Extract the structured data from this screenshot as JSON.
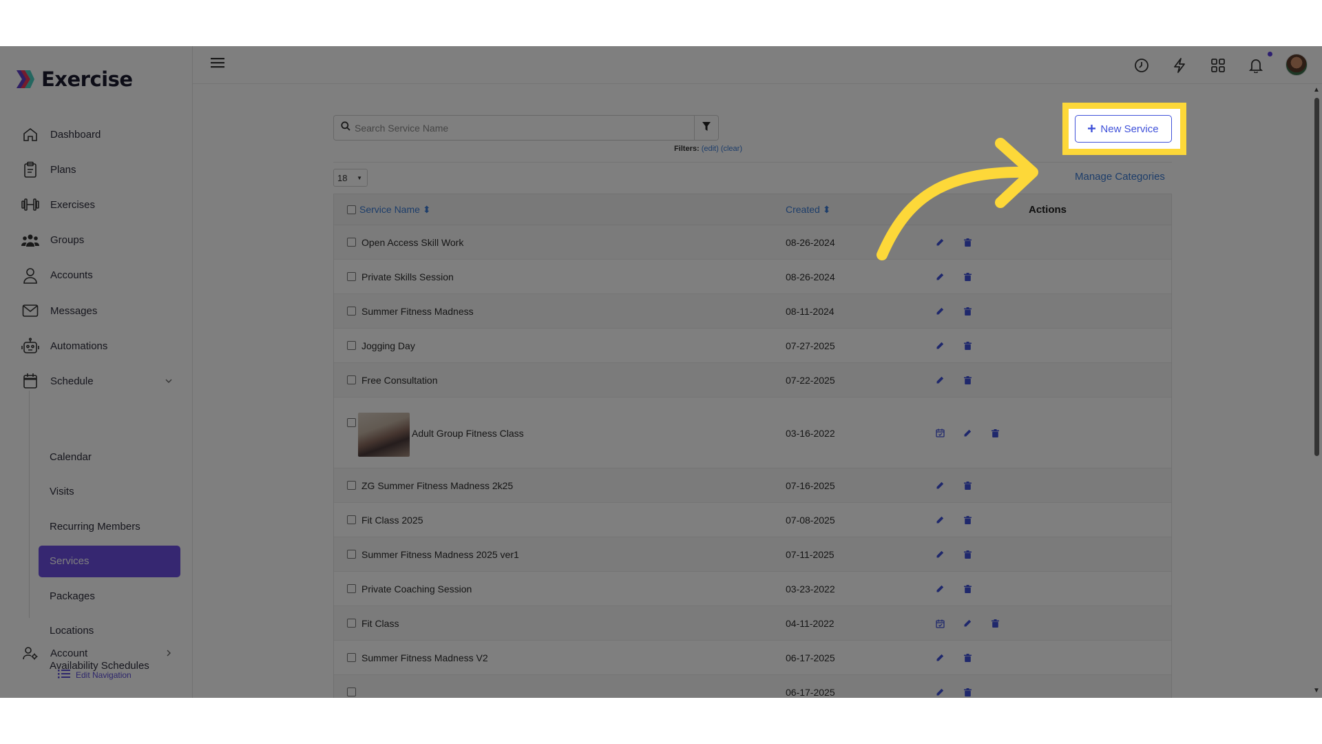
{
  "app": {
    "name": "Exercise"
  },
  "sidebar": {
    "items": [
      {
        "label": "Dashboard",
        "icon": "home-icon"
      },
      {
        "label": "Plans",
        "icon": "clipboard-icon"
      },
      {
        "label": "Exercises",
        "icon": "dumbbell-icon"
      },
      {
        "label": "Groups",
        "icon": "users-icon"
      },
      {
        "label": "Accounts",
        "icon": "user-icon"
      },
      {
        "label": "Messages",
        "icon": "envelope-icon"
      },
      {
        "label": "Automations",
        "icon": "robot-icon"
      },
      {
        "label": "Schedule",
        "icon": "calendar-icon"
      }
    ],
    "schedule_children": [
      {
        "label": "Calendar"
      },
      {
        "label": "Visits"
      },
      {
        "label": "Recurring Members"
      },
      {
        "label": "Services",
        "active": true
      },
      {
        "label": "Packages"
      },
      {
        "label": "Locations"
      },
      {
        "label": "Availability Schedules"
      }
    ],
    "account": {
      "label": "Account",
      "icon": "user-gear-icon"
    },
    "edit_navigation": "Edit Navigation"
  },
  "topbar": {
    "icons": [
      "clock-icon",
      "bolt-icon",
      "grid-icon",
      "bell-icon"
    ]
  },
  "search": {
    "placeholder": "Search Service Name"
  },
  "filters": {
    "label": "Filters:",
    "edit": "(edit)",
    "clear": "(clear)"
  },
  "per_page": "18",
  "manage_categories": "Manage Categories",
  "new_service": "New Service",
  "table": {
    "headers": {
      "name": "Service Name",
      "created": "Created",
      "actions": "Actions"
    },
    "rows": [
      {
        "name": "Open Access Skill Work",
        "created": "08-26-2024",
        "calendar": false
      },
      {
        "name": "Private Skills Session",
        "created": "08-26-2024",
        "calendar": false
      },
      {
        "name": "Summer Fitness Madness",
        "created": "08-11-2024",
        "calendar": false
      },
      {
        "name": "Jogging Day",
        "created": "07-27-2025",
        "calendar": false
      },
      {
        "name": "Free Consultation",
        "created": "07-22-2025",
        "calendar": false
      },
      {
        "name": "Adult Group Fitness Class",
        "created": "03-16-2022",
        "calendar": true,
        "thumbnail": true
      },
      {
        "name": "ZG Summer Fitness Madness 2k25",
        "created": "07-16-2025",
        "calendar": false
      },
      {
        "name": "Fit Class 2025",
        "created": "07-08-2025",
        "calendar": false
      },
      {
        "name": "Summer Fitness Madness 2025 ver1",
        "created": "07-11-2025",
        "calendar": false
      },
      {
        "name": "Private Coaching Session",
        "created": "03-23-2022",
        "calendar": false
      },
      {
        "name": "Fit Class",
        "created": "04-11-2022",
        "calendar": true
      },
      {
        "name": "Summer Fitness Madness V2",
        "created": "06-17-2025",
        "calendar": false
      },
      {
        "name": "",
        "created": "06-17-2025",
        "calendar": false
      }
    ]
  },
  "colors": {
    "accent": "#6c4fe3",
    "link": "#3a7bd5",
    "button": "#3f51d9",
    "highlight": "#fdd839"
  }
}
